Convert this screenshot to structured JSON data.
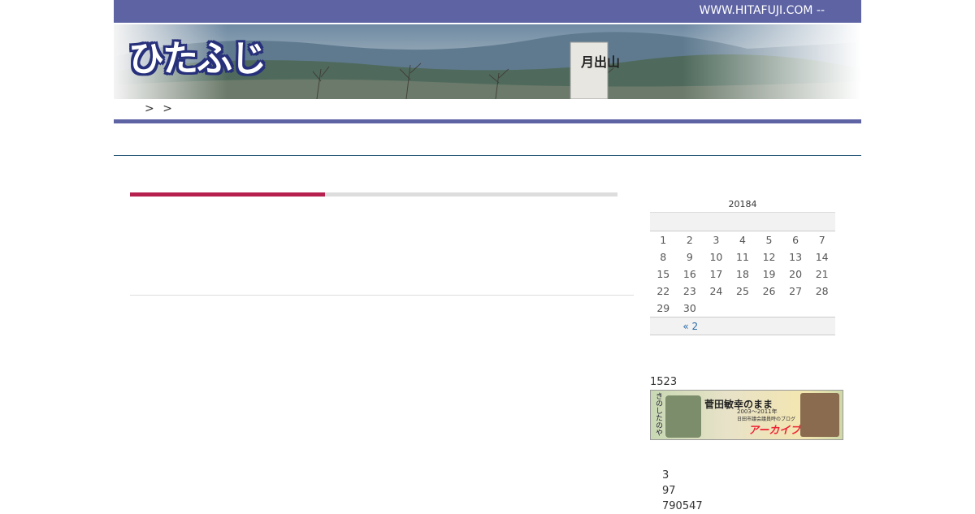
{
  "header": {
    "site_url": "WWW.HITAFUJI.COM --",
    "logo_text": "ひたふじ",
    "banner_sign_text": "月出山"
  },
  "breadcrumb": {
    "separators": [
      ">",
      ">"
    ]
  },
  "colors": {
    "nav": "#5d63a3",
    "accent": "#b5204f",
    "link": "#2a6aa8"
  },
  "main": {
    "progress_fraction": 0.4
  },
  "calendar": {
    "caption": "20184",
    "weeks": [
      [
        "1",
        "2",
        "3",
        "4",
        "5",
        "6",
        "7"
      ],
      [
        "8",
        "9",
        "10",
        "11",
        "12",
        "13",
        "14"
      ],
      [
        "15",
        "16",
        "17",
        "18",
        "19",
        "20",
        "21"
      ],
      [
        "22",
        "23",
        "24",
        "25",
        "26",
        "27",
        "28"
      ],
      [
        "29",
        "30",
        "",
        "",
        "",
        "",
        ""
      ]
    ],
    "prev_link": "« 2"
  },
  "counter": {
    "title": "1523"
  },
  "ad_banner": {
    "title": "菅田敏幸のまま",
    "years": "2003～2011年",
    "subtitle": "日田市議会議員時のブログ",
    "archive": "アーカイブス",
    "side_text": "きのしたのや"
  },
  "stats": [
    "3",
    "97",
    "790547"
  ]
}
